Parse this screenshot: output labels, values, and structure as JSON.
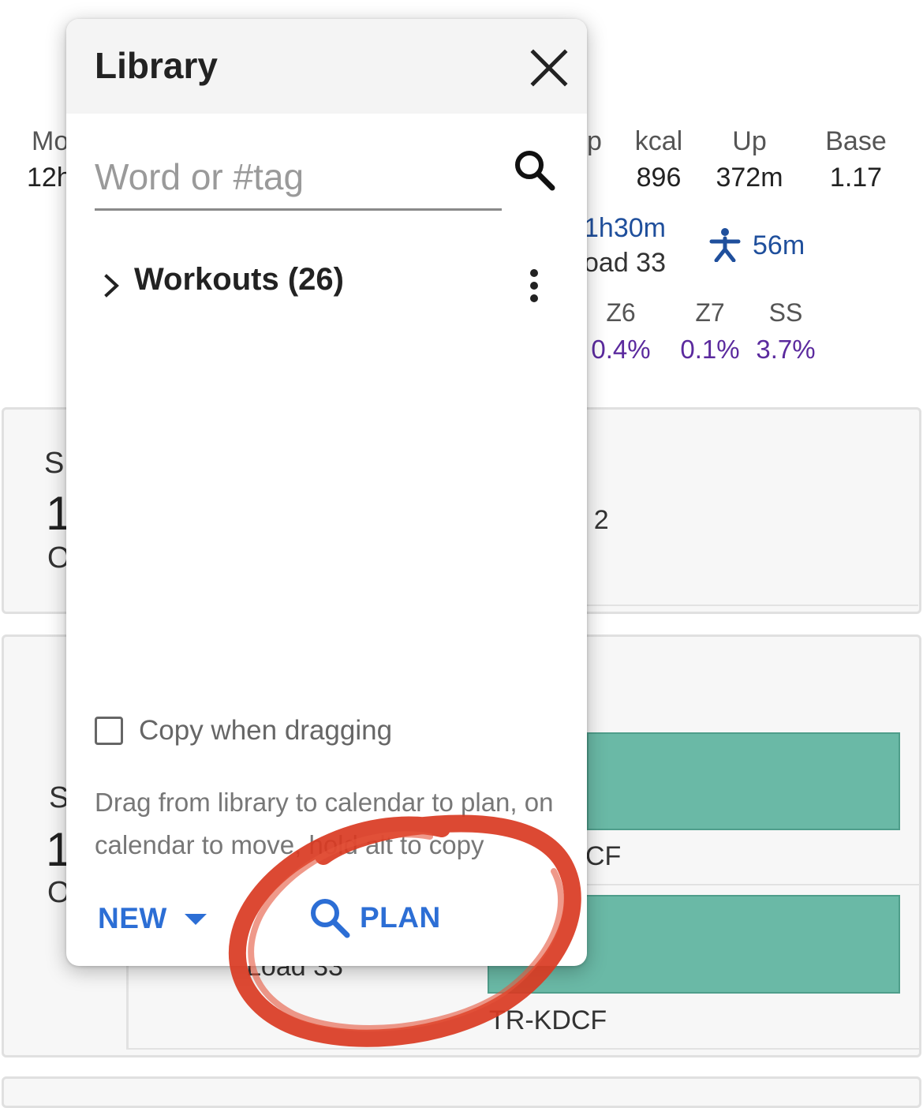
{
  "background": {
    "stats": {
      "col1": {
        "label_frag": "Mo",
        "value_frag": "12h"
      },
      "col2": {
        "label_frag": "p"
      },
      "kcal": {
        "label": "kcal",
        "value": "896"
      },
      "up": {
        "label": "Up",
        "value": "372m"
      },
      "base": {
        "label": "Base",
        "value": "1.17"
      }
    },
    "duration": "1h30m",
    "load_frag": "oad 33",
    "run_time": "56m",
    "zones": [
      {
        "label": "Z6",
        "value": "0.4%"
      },
      {
        "label": "Z7",
        "value": "0.1%"
      },
      {
        "label": "SS",
        "value": "3.7%"
      }
    ],
    "card1": {
      "frag_s": "S",
      "frag_1": "1",
      "frag_o": "O",
      "frag_right": "r 2"
    },
    "card2": {
      "frag_s": "S",
      "frag_1": "1",
      "frag_o": "O",
      "workout1_frag": "CF",
      "load_frag": "Load 33",
      "workout2": "TR-KDCF"
    }
  },
  "library": {
    "title": "Library",
    "search_placeholder": "Word or #tag",
    "search_value": "",
    "folder_label": "Workouts (26)",
    "copy_label": "Copy when dragging",
    "copy_checked": false,
    "help_text": "Drag from library to calendar to plan, on calendar to move, hold alt to copy",
    "new_label": "NEW",
    "plan_label": "PLAN"
  },
  "colors": {
    "accent_blue": "#2c6ed5",
    "annotation_red": "#d93a22",
    "bar_green": "#6ab9a6",
    "zone_purple": "#5b2a9e"
  },
  "icons": [
    "close-icon",
    "search-icon",
    "chevron-right-icon",
    "more-vert-icon",
    "caret-down-icon",
    "running-icon"
  ]
}
